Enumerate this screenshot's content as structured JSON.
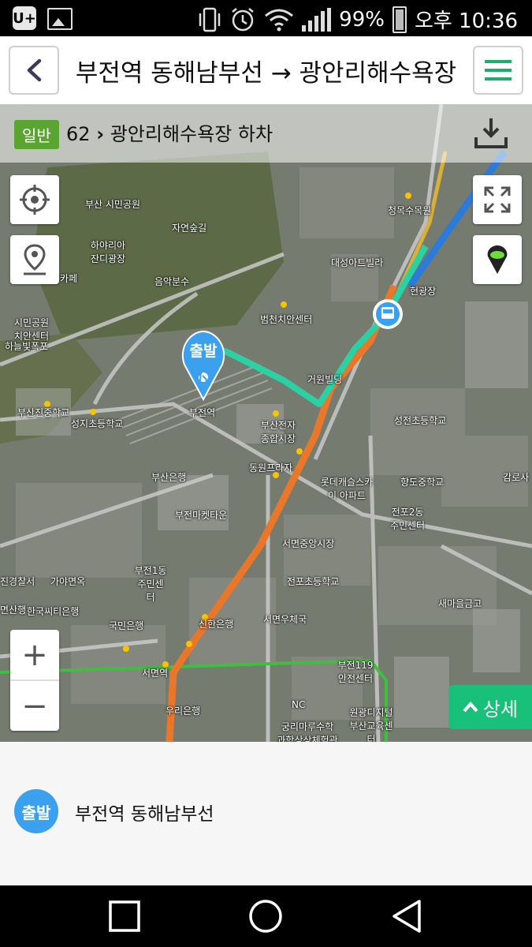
{
  "status_bar": {
    "battery": "99%",
    "time": "오후 10:36",
    "carrier_icon": "U+"
  },
  "header": {
    "title": "부전역 동해남부선 → 광안리해수욕장",
    "back_icon": "chevron-left-icon",
    "menu_icon": "hamburger-menu-icon"
  },
  "route_info": {
    "badge": "일반",
    "bus_number": "62",
    "description": "광안리해수욕장 하차"
  },
  "map": {
    "start_marker_label": "출발",
    "detail_button_label": "상세",
    "zoom_in": "+",
    "zoom_out": "−",
    "labels": [
      "부산 시민공원",
      "자연숲길",
      "하야리아 잔디광장",
      "음악분수",
      "시민공원 치안센터",
      "하늘빛폭포",
      "카페",
      "부산진중학교",
      "성지초등학교",
      "범천치안센터",
      "대성아트빌라",
      "청목수목원",
      "현광장",
      "거원빌딩",
      "부전역",
      "부산전자 종합시장",
      "동원프라자",
      "부산은행",
      "롯데캐슬스카이 아파트",
      "부전마켓타운",
      "서면중앙시장",
      "부전1동 주민센터",
      "전포2동 주민센터",
      "향도중학교",
      "새마을금고",
      "감로사",
      "진경찰서",
      "가야면옥",
      "한국씨티은행",
      "국민은행",
      "신한은행",
      "서면우체국",
      "전포초등학교",
      "부전119 안전센터",
      "우리은행",
      "서면역",
      "NC",
      "궁리마루수학 과학상상체험관",
      "원광디지털 부산교육센터",
      "성전초등학교",
      "면산행"
    ],
    "colors": {
      "walk_route": "#2bd0a3",
      "bus_route": "#e8772a",
      "subway_line": "#3fbf3f"
    }
  },
  "departure": {
    "badge": "출발",
    "name": "부전역 동해남부선"
  }
}
